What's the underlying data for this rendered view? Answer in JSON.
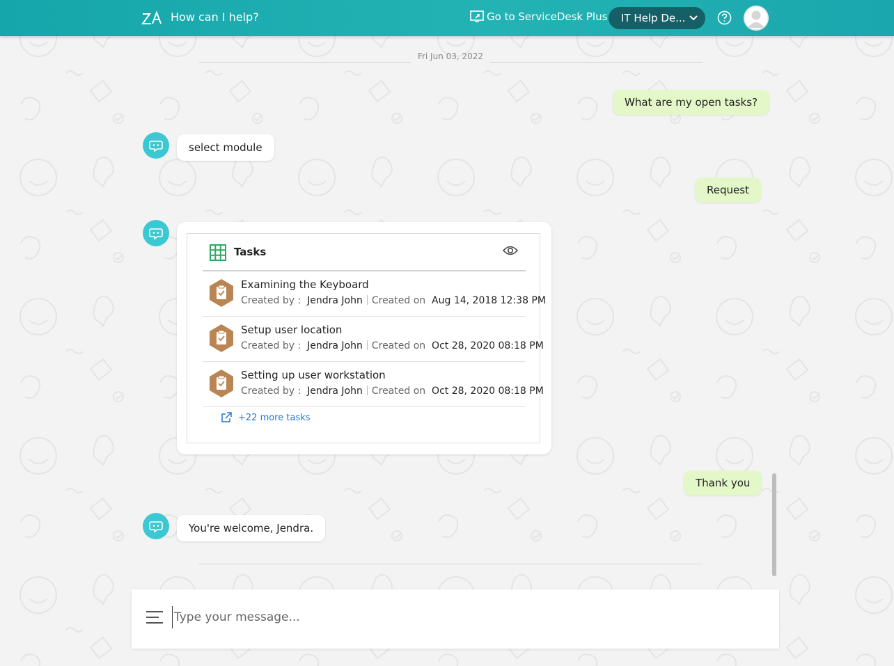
{
  "header": {
    "title": "How can I help?",
    "sdp_link": "Go to ServiceDesk Plus",
    "instance": "IT Help De...",
    "help_icon": "question-circle-icon",
    "avatar_icon": "user-avatar-icon"
  },
  "chat": {
    "date": "Fri Jun 03, 2022",
    "messages": [
      {
        "from": "user",
        "text": "What are my open tasks?"
      },
      {
        "from": "bot",
        "text": "select module"
      },
      {
        "from": "user",
        "text": "Request"
      },
      {
        "from": "user",
        "text": "Thank you"
      },
      {
        "from": "bot",
        "text": "You're welcome, Jendra."
      }
    ]
  },
  "tasks_card": {
    "title": "Tasks",
    "created_by_label": "Created by :",
    "created_on_label": "Created on",
    "items": [
      {
        "title": "Examining the Keyboard",
        "created_by": "Jendra John",
        "created_on": "Aug 14, 2018 12:38 PM"
      },
      {
        "title": "Setup user location",
        "created_by": "Jendra John",
        "created_on": "Oct 28, 2020 08:18 PM"
      },
      {
        "title": "Setting up user workstation",
        "created_by": "Jendra John",
        "created_on": "Oct 28, 2020 08:18 PM"
      }
    ],
    "more_link": "+22 more tasks"
  },
  "composer": {
    "placeholder": "Type your message..."
  },
  "colors": {
    "header": "#1faeb1",
    "user_bubble": "#e4f7c8",
    "bot_avatar": "#3cc8d3",
    "link": "#1e78d6",
    "task_icon": "#b98552"
  }
}
